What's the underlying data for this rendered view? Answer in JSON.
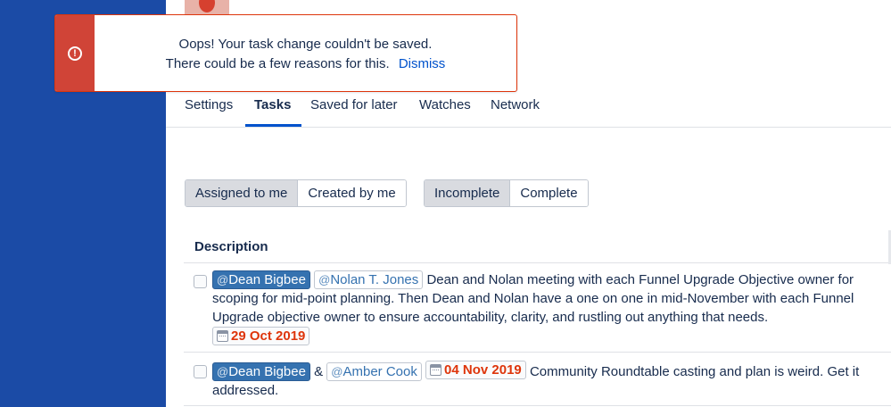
{
  "tabs": {
    "settings": "Settings",
    "tasks": "Tasks",
    "saved": "Saved for later",
    "watches": "Watches",
    "network": "Network"
  },
  "filters": {
    "assigned": "Assigned to me",
    "created": "Created by me",
    "incomplete": "Incomplete",
    "complete": "Complete"
  },
  "table": {
    "header": "Description"
  },
  "tasks": [
    {
      "mention1": "Dean Bigbee",
      "mention2": "Nolan T. Jones",
      "text": "Dean and Nolan meeting with each Funnel Upgrade Objective owner for scoping for mid-point planning. Then Dean and Nolan have a one on one in mid-November with each Funnel Upgrade objective owner to ensure accountability, clarity, and rustling out anything that needs.",
      "date": "29 Oct 2019"
    },
    {
      "mention1": "Dean Bigbee",
      "joiner": "&",
      "mention2": "Amber Cook",
      "date": "04 Nov 2019",
      "text": "Community Roundtable casting and plan is weird. Get it addressed."
    }
  ],
  "flag": {
    "line1": "Oops! Your task change couldn't be saved.",
    "line2": "There could be a few reasons for this.",
    "dismiss": "Dismiss",
    "icon": "error-icon"
  },
  "at_symbol": "@",
  "colors": {
    "sidebar": "#1b4ba6",
    "accent": "#0052cc",
    "error": "#d04437",
    "date": "#de350b"
  }
}
